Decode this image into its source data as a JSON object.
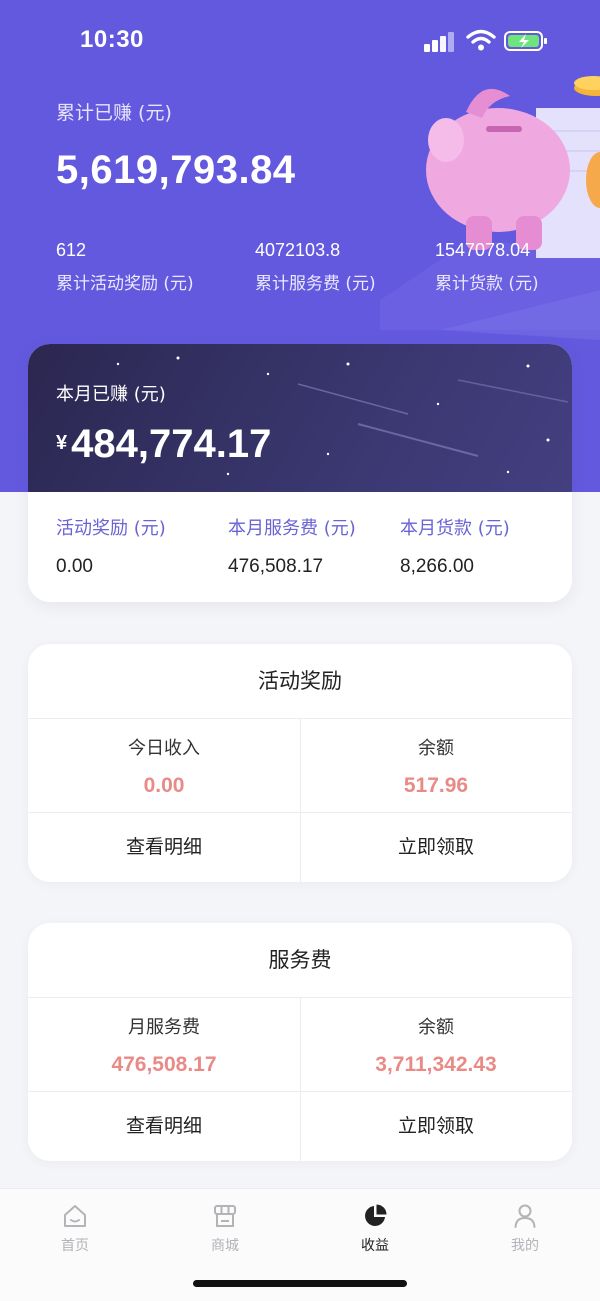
{
  "status_bar": {
    "time": "10:30"
  },
  "summary": {
    "total_label": "累计已赚 (元)",
    "total_value": "5,619,793.84",
    "stats": [
      {
        "value": "612",
        "label": "累计活动奖励 (元)"
      },
      {
        "value": "4072103.8",
        "label": "累计服务费 (元)"
      },
      {
        "value": "1547078.04",
        "label": "累计货款 (元)"
      }
    ]
  },
  "month": {
    "label": "本月已赚 (元)",
    "currency": "¥",
    "value": "484,774.17",
    "stats": [
      {
        "label": "活动奖励 (元)",
        "value": "0.00"
      },
      {
        "label": "本月服务费 (元)",
        "value": "476,508.17"
      },
      {
        "label": "本月货款 (元)",
        "value": "8,266.00"
      }
    ]
  },
  "activity_card": {
    "title": "活动奖励",
    "left": {
      "label": "今日收入",
      "value": "0.00"
    },
    "right": {
      "label": "余额",
      "value": "517.96"
    },
    "actions": {
      "detail": "查看明细",
      "claim": "立即领取"
    }
  },
  "service_card": {
    "title": "服务费",
    "left": {
      "label": "月服务费",
      "value": "476,508.17"
    },
    "right": {
      "label": "余额",
      "value": "3,711,342.43"
    },
    "actions": {
      "detail": "查看明细",
      "claim": "立即领取"
    }
  },
  "tabbar": {
    "items": [
      {
        "label": "首页",
        "icon": "home-icon"
      },
      {
        "label": "商城",
        "icon": "store-icon"
      },
      {
        "label": "收益",
        "icon": "pie-chart-icon",
        "active": true
      },
      {
        "label": "我的",
        "icon": "user-icon"
      }
    ]
  },
  "colors": {
    "hero": "#6359de",
    "accent_text": "#6a63d4",
    "value_red": "#e98a87",
    "night_card": "#2b2750"
  }
}
